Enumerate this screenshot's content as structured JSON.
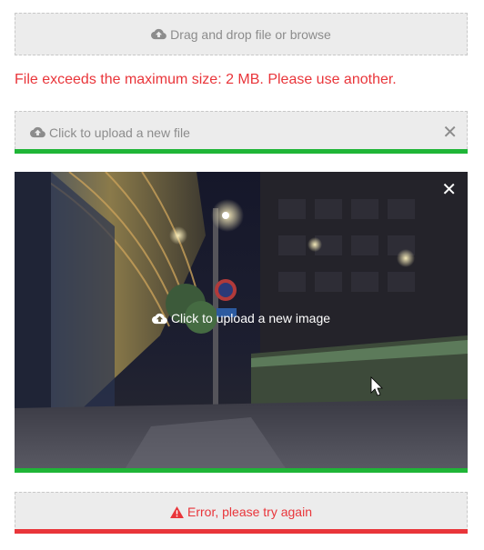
{
  "upload_default": {
    "icon": "cloud-upload-icon",
    "label": "Drag and drop file or browse"
  },
  "error_message": "File exceeds the maximum size: 2 MB. Please use another.",
  "upload_file": {
    "icon": "cloud-upload-icon",
    "label": "Click to upload a new file",
    "close_icon": "close-icon",
    "close_glyph": "✕",
    "progress": 1.0,
    "progress_color": "#1fb537"
  },
  "upload_image": {
    "icon": "cloud-upload-icon",
    "label": "Click to upload a new image",
    "close_icon": "close-icon",
    "close_glyph": "✕",
    "progress": 1.0,
    "progress_color": "#1fb537"
  },
  "upload_error": {
    "icon": "warning-icon",
    "label": "Error, please try again",
    "progress": 1.0,
    "progress_color": "#e9353a"
  },
  "colors": {
    "error_red": "#e9353a",
    "success_green": "#1fb537",
    "dropzone_bg": "#ececec",
    "muted_text": "#8c8c8c"
  }
}
